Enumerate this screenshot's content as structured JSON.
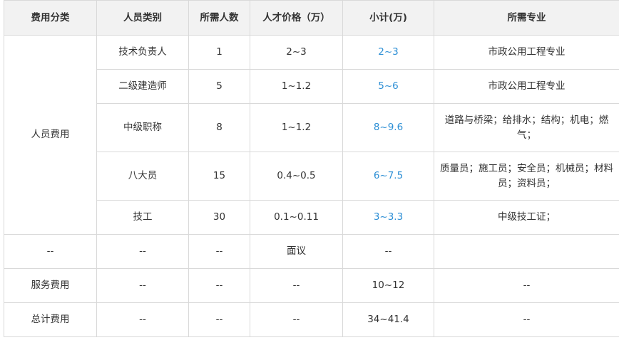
{
  "headers": [
    "费用分类",
    "人员类别",
    "所需人数",
    "人才价格（万）",
    "小计(万)",
    "所需专业"
  ],
  "personnel": {
    "category": "人员费用",
    "rows": [
      {
        "type": "技术负责人",
        "count": "1",
        "price": "2~3",
        "subtotal": "2~3",
        "major": "市政公用工程专业"
      },
      {
        "type": "二级建造师",
        "count": "5",
        "price": "1~1.2",
        "subtotal": "5~6",
        "major": "市政公用工程专业"
      },
      {
        "type": "中级职称",
        "count": "8",
        "price": "1~1.2",
        "subtotal": "8~9.6",
        "major": "道路与桥梁；给排水；结构；机电；燃气；"
      },
      {
        "type": "八大员",
        "count": "15",
        "price": "0.4~0.5",
        "subtotal": "6~7.5",
        "major": "质量员；施工员；安全员；机械员；材料员；资料员；"
      },
      {
        "type": "技工",
        "count": "30",
        "price": "0.1~0.11",
        "subtotal": "3~3.3",
        "major": "中级技工证；"
      }
    ]
  },
  "negotiable": {
    "category": "--",
    "type": "--",
    "count": "--",
    "price": "面议",
    "subtotal": "--",
    "major": ""
  },
  "service": {
    "category": "服务费用",
    "type": "--",
    "count": "--",
    "price": "--",
    "subtotal": "10~12",
    "major": "--"
  },
  "total": {
    "category": "总计费用",
    "type": "--",
    "count": "--",
    "price": "--",
    "subtotal": "34~41.4",
    "major": "--"
  },
  "colors": {
    "subtotal_highlight": "#2d8fd5",
    "header_bg": "#f2f2f2",
    "border": "#d9d9d9"
  }
}
